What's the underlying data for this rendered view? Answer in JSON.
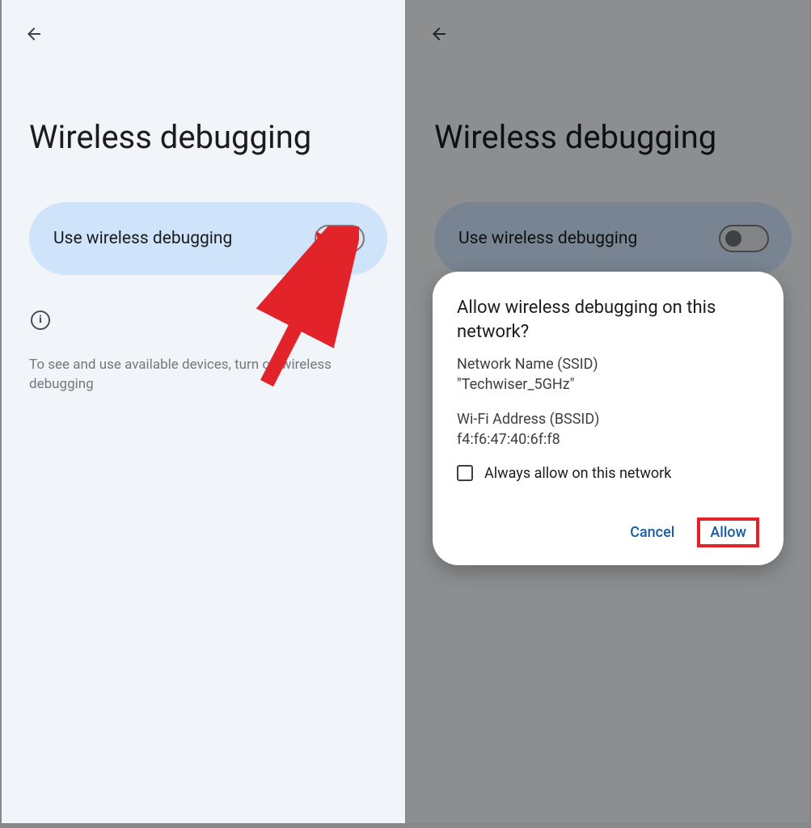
{
  "left": {
    "title": "Wireless debugging",
    "toggle_label": "Use wireless debugging",
    "help_text": "To see and use available devices, turn on wireless debugging"
  },
  "right": {
    "title": "Wireless debugging",
    "toggle_label": "Use wireless debugging",
    "dialog": {
      "title": "Allow wireless debugging on this network?",
      "ssid_label": "Network Name (SSID)",
      "ssid_value": "\"Techwiser_5GHz\"",
      "bssid_label": "Wi-Fi Address (BSSID)",
      "bssid_value": "f4:f6:47:40:6f:f8",
      "always_label": "Always allow on this network",
      "cancel": "Cancel",
      "allow": "Allow"
    }
  }
}
